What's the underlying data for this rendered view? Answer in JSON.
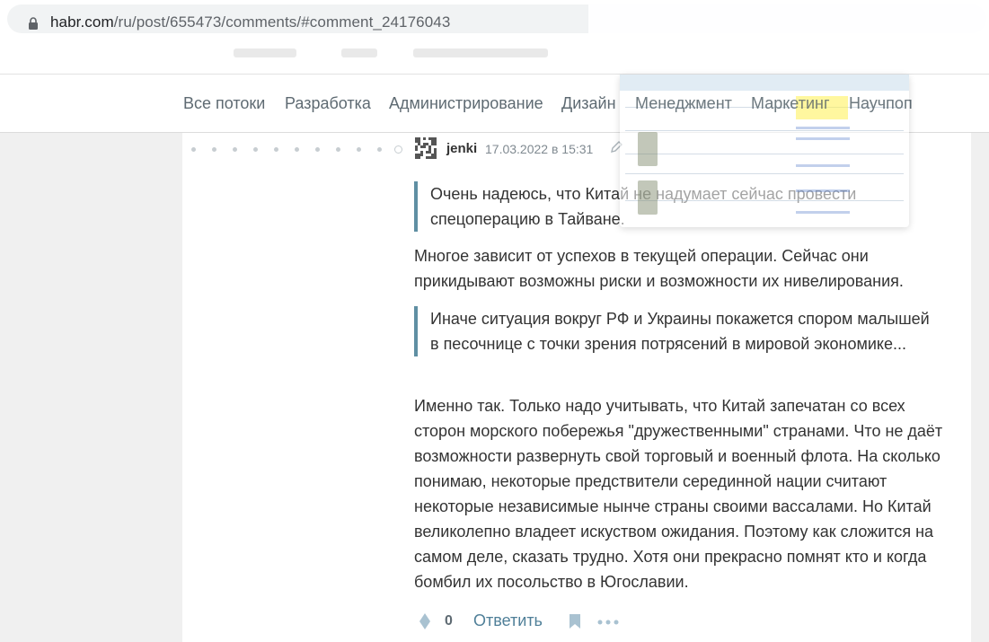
{
  "browser": {
    "url_host": "habr.com",
    "url_path": "/ru/post/655473/comments/#comment_24176043"
  },
  "nav": {
    "items": [
      {
        "label": "Все потоки"
      },
      {
        "label": "Разработка"
      },
      {
        "label": "Администрирование"
      },
      {
        "label": "Дизайн"
      },
      {
        "label": "Менеджмент"
      },
      {
        "label": "Маркетинг"
      },
      {
        "label": "Научпоп"
      }
    ]
  },
  "comment": {
    "username": "jenki",
    "timestamp": "17.03.2022 в 15:31",
    "quote1": "Очень надеюсь, что Китай не надумает сейчас провести спецоперацию в Тайване.",
    "para1": "Многое зависит от успехов в текущей операции. Сейчас они прикидывают возможны риски и возможности их нивелирования.",
    "quote2": "Иначе ситуация вокруг РФ и Украины покажется спором малышей в песочнице с точки зрения потрясений в мировой экономике...",
    "para2": "Именно так. Только надо учитывать, что Китай запечатан со всех сторон морского побережья \"дружественными\" странами. Что не даёт возможности развернуть свой торговый и военный флота. На сколько понимаю, некоторые предствители серединной нации считают некоторые независимые нынче страны своими вассалами. Но Китай великолепно владеет искуством ожидания. Поэтому как сложится на самом деле, сказать трудно. Хотя они прекрасно помнят кто и когда бомбил их посольство в Югославии.",
    "vote_count": "0",
    "reply_label": "Ответить"
  },
  "icons": {
    "lock": "lock-icon",
    "vote": "vote-icon",
    "bookmark": "bookmark-icon",
    "more": "more-icon",
    "edit": "edit-icon"
  },
  "colors": {
    "link": "#4f7f98",
    "quote_bar": "#5f8fa3",
    "text": "#333333",
    "muted": "#808a91"
  }
}
